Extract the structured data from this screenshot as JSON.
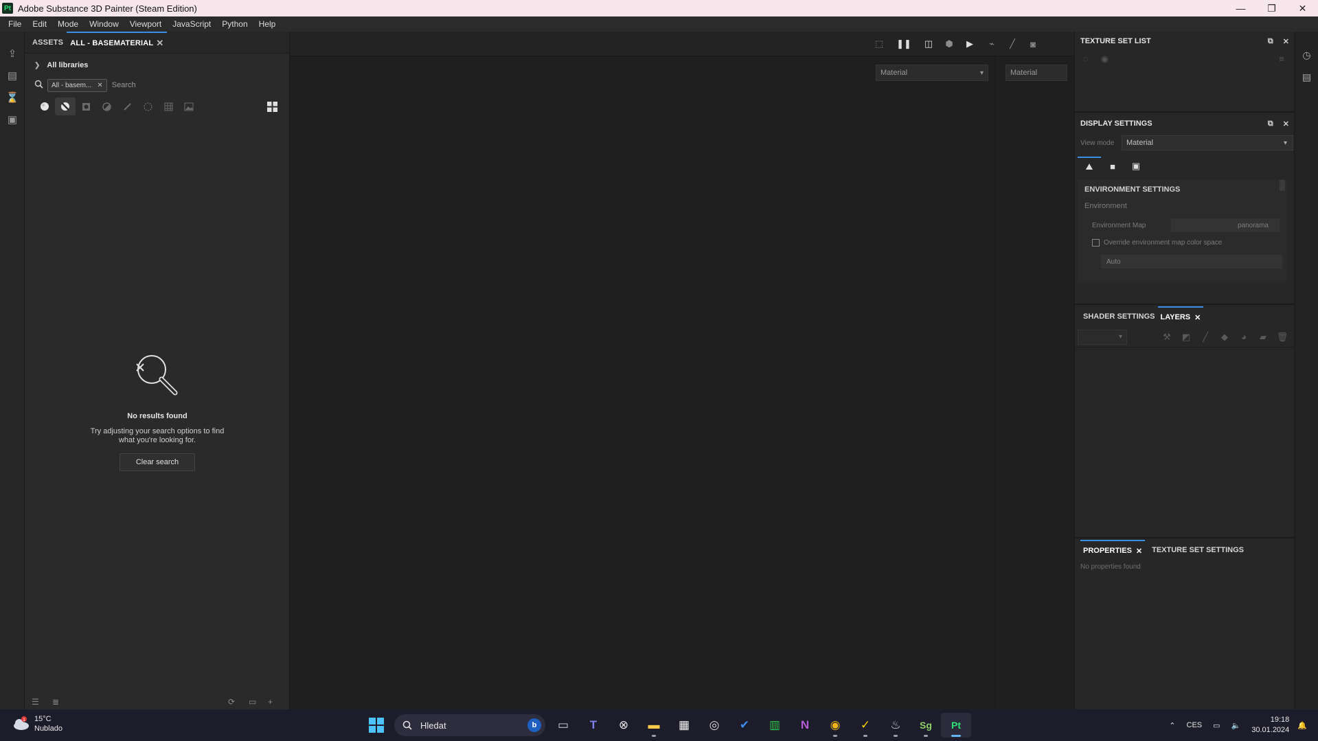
{
  "window": {
    "app_badge": "Pt",
    "title": "Adobe Substance 3D Painter (Steam Edition)",
    "controls": [
      "—",
      "❐",
      "✕"
    ]
  },
  "menu": [
    "File",
    "Edit",
    "Mode",
    "Window",
    "Viewport",
    "JavaScript",
    "Python",
    "Help"
  ],
  "assets": {
    "tabs": [
      "ASSETS",
      "ALL - BASEMATERIAL"
    ],
    "close": "✕",
    "library_label": "All libraries",
    "filter_chip": "All - basem...",
    "filter_chip_close": "✕",
    "search_placeholder": "Search",
    "empty": {
      "title": "No results found",
      "subtitle": "Try adjusting your search options to find what you're looking for.",
      "button": "Clear search"
    }
  },
  "viewport": {
    "view_select_left": "Material",
    "view_select_right": "Material"
  },
  "texture_set_list": {
    "title": "TEXTURE SET LIST"
  },
  "display_settings": {
    "title": "DISPLAY SETTINGS",
    "view_mode_label": "View mode",
    "view_mode_value": "Material",
    "env_section_title": "ENVIRONMENT SETTINGS",
    "env_subtitle": "Environment",
    "env_map_label": "Environment Map",
    "env_map_value": "panorama",
    "override_label": "Override environment map color space",
    "override_checked": false,
    "color_space_value": "Auto"
  },
  "layers": {
    "tabs": [
      "SHADER SETTINGS",
      "LAYERS"
    ],
    "close": "✕"
  },
  "properties": {
    "tabs": [
      "PROPERTIES",
      "TEXTURE SET SETTINGS"
    ],
    "close": "✕",
    "empty": "No properties found"
  },
  "taskbar": {
    "weather_temp": "15°C",
    "weather_desc": "Nublado",
    "weather_badge": "1",
    "search_text": "Hledat",
    "language": "CES",
    "time": "19:18",
    "date": "30.01.2024",
    "apps": [
      {
        "icon": "windows-start-icon",
        "glyph": "⊞"
      },
      {
        "icon": "task-view-icon",
        "glyph": "▭"
      },
      {
        "icon": "teams-icon",
        "glyph": "T"
      },
      {
        "icon": "xbox-icon",
        "glyph": "⊗"
      },
      {
        "icon": "file-explorer-icon",
        "glyph": "▬"
      },
      {
        "icon": "store-icon",
        "glyph": "▦"
      },
      {
        "icon": "app-circle-icon",
        "glyph": "◎"
      },
      {
        "icon": "todo-icon",
        "glyph": "✔"
      },
      {
        "icon": "excel-icon",
        "glyph": "▥"
      },
      {
        "icon": "onenote-icon",
        "glyph": "N"
      },
      {
        "icon": "chrome-icon",
        "glyph": "◉"
      },
      {
        "icon": "norton-icon",
        "glyph": "✓"
      },
      {
        "icon": "steam-icon",
        "glyph": "♨"
      },
      {
        "icon": "substance-designer-icon",
        "glyph": "Sg"
      },
      {
        "icon": "substance-painter-icon",
        "glyph": "Pt"
      }
    ]
  },
  "colors": {
    "accent": "#3a8ee6",
    "panel_bg": "#2a2a2a",
    "viewport_bg": "#1f1f1f",
    "titlebar_bg": "#f7e6ec",
    "taskbar_bg": "#1c1c2a"
  }
}
